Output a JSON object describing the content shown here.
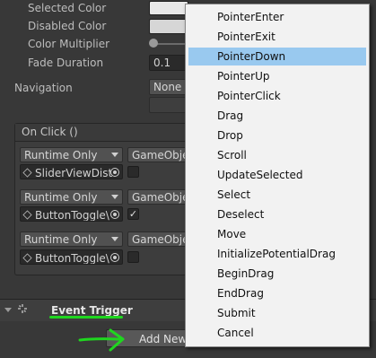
{
  "inspector": {
    "selected_color_label": "Selected Color",
    "disabled_color_label": "Disabled Color",
    "color_multiplier_label": "Color Multiplier",
    "fade_duration_label": "Fade Duration",
    "fade_duration_value": "0.1",
    "navigation_label": "Navigation",
    "navigation_value": "None",
    "color_multiplier_value": 1
  },
  "on_click": {
    "header": "On Click ()",
    "rows": [
      {
        "runtime": "Runtime Only",
        "function": "GameObjec",
        "target": "SliderViewDist",
        "checked": false
      },
      {
        "runtime": "Runtime Only",
        "function": "GameObjec",
        "target": "ButtonToggle\\",
        "checked": true
      },
      {
        "runtime": "Runtime Only",
        "function": "GameObjec",
        "target": "ButtonToggle\\",
        "checked": false
      }
    ]
  },
  "event_trigger": {
    "title": "Event Trigger",
    "add_button": "Add New"
  },
  "menu": {
    "items": [
      "PointerEnter",
      "PointerExit",
      "PointerDown",
      "PointerUp",
      "PointerClick",
      "Drag",
      "Drop",
      "Scroll",
      "UpdateSelected",
      "Select",
      "Deselect",
      "Move",
      "InitializePotentialDrag",
      "BeginDrag",
      "EndDrag",
      "Submit",
      "Cancel"
    ],
    "selected": "PointerDown"
  },
  "colors": {
    "panel_bg": "#383838",
    "menu_bg": "#f2f2f2",
    "menu_highlight": "#99c9ef",
    "annotation_green": "#1fd61f"
  }
}
